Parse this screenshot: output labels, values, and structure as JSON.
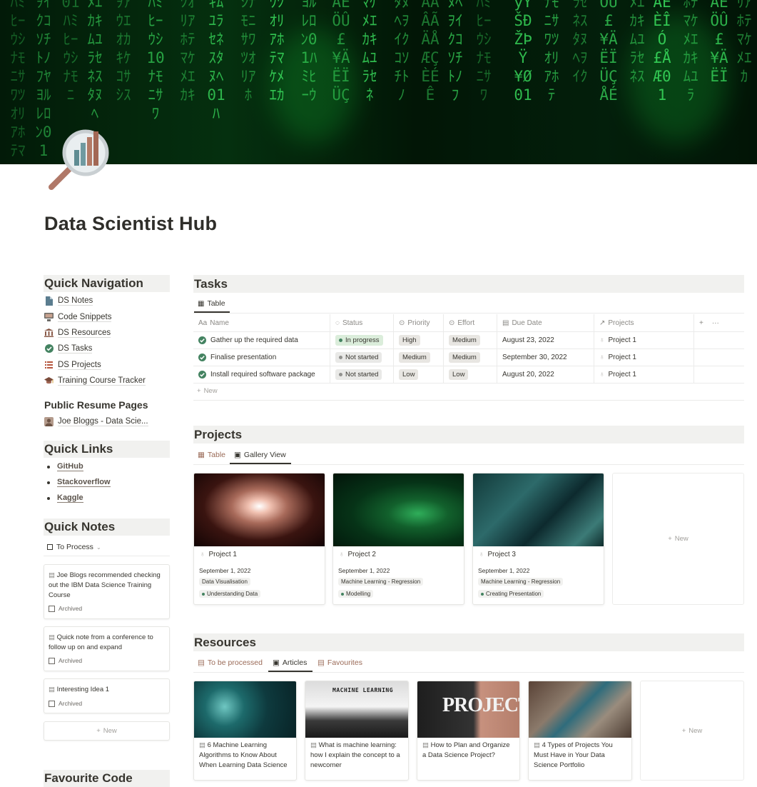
{
  "page": {
    "title": "Data Scientist Hub"
  },
  "quick_navigation": {
    "heading": "Quick Navigation",
    "items": [
      {
        "label": "DS Notes",
        "icon": "document-icon"
      },
      {
        "label": "Code Snippets",
        "icon": "computer-icon"
      },
      {
        "label": "DS Resources",
        "icon": "bank-icon"
      },
      {
        "label": "DS Tasks",
        "icon": "check-circle-icon"
      },
      {
        "label": "DS Projects",
        "icon": "list-icon"
      },
      {
        "label": "Training Course Tracker",
        "icon": "graduation-cap-icon"
      }
    ]
  },
  "public_resume": {
    "heading": "Public Resume Pages",
    "items": [
      {
        "label": "Joe Bloggs - Data Scie...",
        "icon": "avatar-icon"
      }
    ]
  },
  "quick_links": {
    "heading": "Quick Links",
    "items": [
      {
        "label": "GitHub"
      },
      {
        "label": "Stackoverflow"
      },
      {
        "label": "Kaggle"
      }
    ]
  },
  "quick_notes": {
    "heading": "Quick Notes",
    "view_label": "To Process",
    "cards": [
      {
        "title": "Joe Blogs recommended checking out the IBM Data Science Training Course",
        "archived_label": "Archived"
      },
      {
        "title": "Quick note from a conference to follow up on and expand",
        "archived_label": "Archived"
      },
      {
        "title": "Interesting Idea 1",
        "archived_label": "Archived"
      }
    ],
    "new_label": "New"
  },
  "tasks": {
    "heading": "Tasks",
    "view_label": "Table",
    "columns": [
      "Name",
      "Status",
      "Priority",
      "Effort",
      "Due Date",
      "Projects"
    ],
    "rows": [
      {
        "name": "Gather up the required data",
        "status": "In progress",
        "priority": "High",
        "effort": "Medium",
        "due": "August 23, 2022",
        "project": "Project 1"
      },
      {
        "name": "Finalise presentation",
        "status": "Not started",
        "priority": "Medium",
        "effort": "Medium",
        "due": "September 30, 2022",
        "project": "Project 1"
      },
      {
        "name": "Install required software package",
        "status": "Not started",
        "priority": "Low",
        "effort": "Low",
        "due": "August 20, 2022",
        "project": "Project 1"
      }
    ],
    "add_column": "+",
    "more": "···",
    "new_label": "New"
  },
  "projects": {
    "heading": "Projects",
    "tabs": [
      {
        "label": "Table"
      },
      {
        "label": "Gallery View"
      }
    ],
    "cards": [
      {
        "title": "Project 1",
        "date": "September 1, 2022",
        "tag1": "Data Visualisation",
        "tag2": "Understanding Data"
      },
      {
        "title": "Project 2",
        "date": "September 1, 2022",
        "tag1": "Machine Learning - Regression",
        "tag2": "Modelling"
      },
      {
        "title": "Project 3",
        "date": "September 1, 2022",
        "tag1": "Machine Learning - Regression",
        "tag2": "Creating Presentation"
      }
    ],
    "new_label": "New"
  },
  "resources": {
    "heading": "Resources",
    "tabs": [
      {
        "label": "To be processed"
      },
      {
        "label": "Articles"
      },
      {
        "label": "Favourites"
      }
    ],
    "cards": [
      {
        "title": "6 Machine Learning Algorithms to Know About When Learning Data Science"
      },
      {
        "title": "What is machine learning: how I explain the concept to a newcomer",
        "image_text": "MACHINE LEARNING"
      },
      {
        "title": "How to Plan and Organize a Data Science Project?",
        "image_text": "PROJECT"
      },
      {
        "title": "4 Types of Projects You Must Have in Your Data Science Portfolio"
      }
    ],
    "new_label": "New"
  },
  "favourite_code": {
    "heading": "Favourite Code"
  },
  "colors": {
    "in_progress_bg": "#dbeddb",
    "in_progress_dot": "#448361",
    "not_started_bg": "#e9e9e7",
    "not_started_dot": "#91918e",
    "tag_bg": "#e8e6e2",
    "section_bg": "#f1f1ef",
    "accent_brown": "#9a6a57"
  }
}
